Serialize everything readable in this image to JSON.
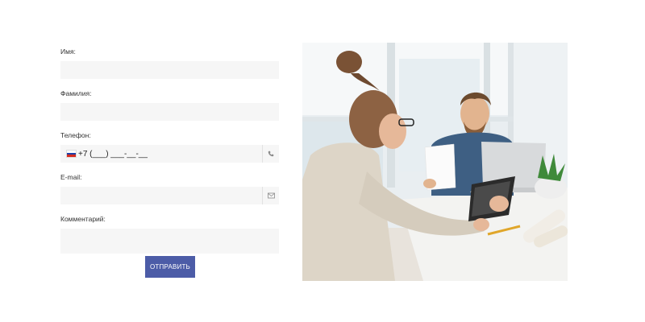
{
  "form": {
    "first_name": {
      "label": "Имя:",
      "value": ""
    },
    "last_name": {
      "label": "Фамилия:",
      "value": ""
    },
    "phone": {
      "label": "Телефон:",
      "value": "+7 (___) ___-__-__",
      "country_icon": "russia-flag-icon",
      "addon_icon": "phone-icon"
    },
    "email": {
      "label": "E-mail:",
      "value": "",
      "addon_icon": "envelope-icon"
    },
    "comment": {
      "label": "Комментарий:",
      "value": ""
    },
    "submit_label": "ОТПРАВИТЬ"
  },
  "photo": {
    "subject": "office-meeting-photo"
  },
  "colors": {
    "accent": "#4c5ca7",
    "field_bg": "#f6f6f6",
    "text": "#333333"
  }
}
